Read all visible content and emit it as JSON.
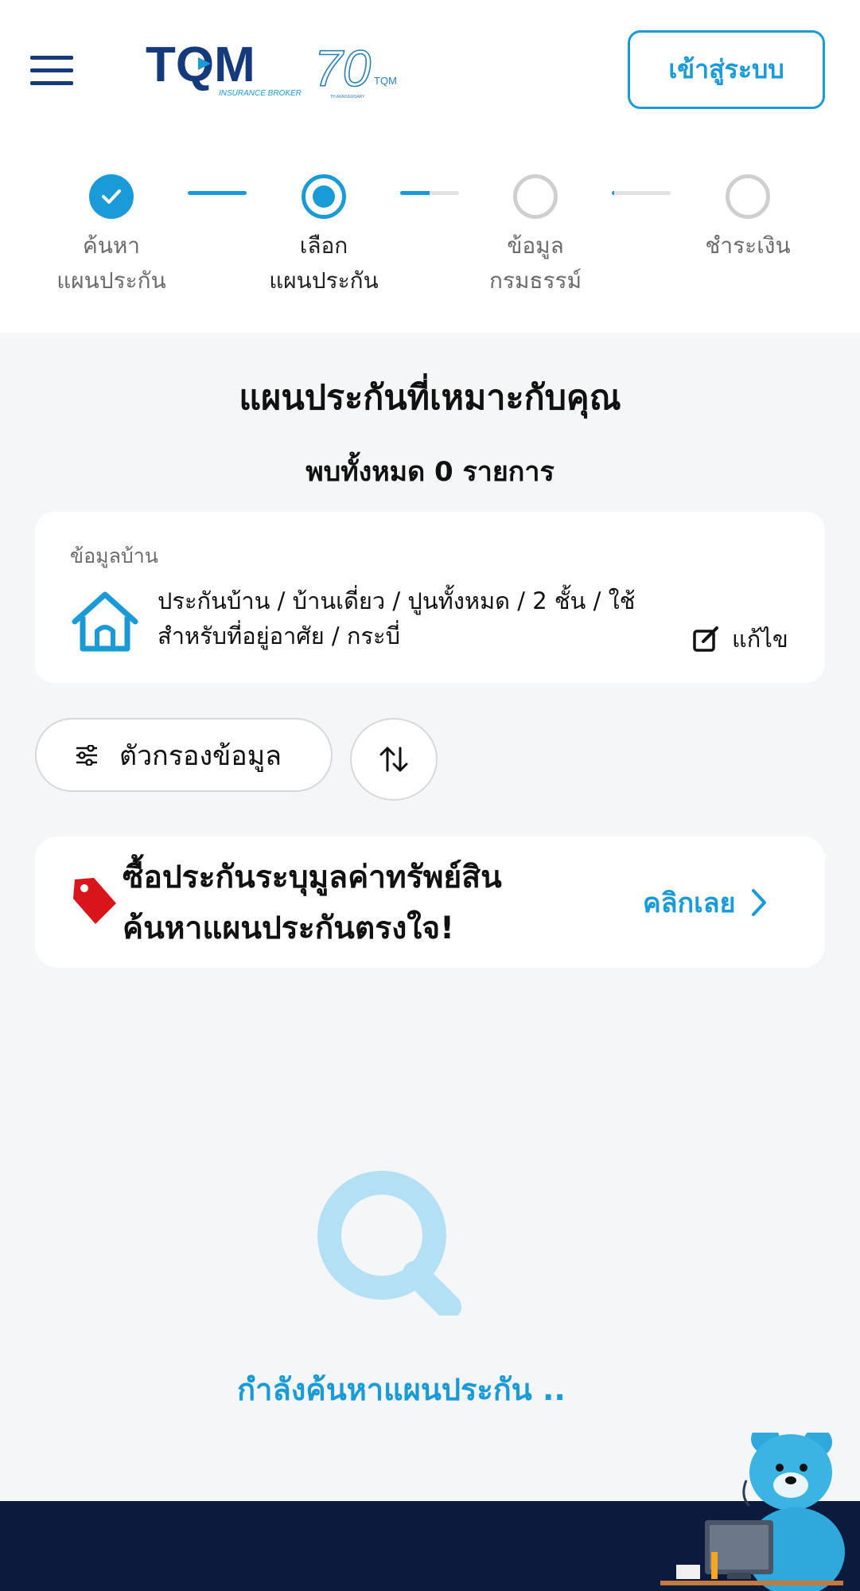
{
  "header": {
    "logo_text": "TQM",
    "logo_subtext": "INSURANCE BROKER",
    "anniversary_text": "70",
    "anniversary_brand": "TQM",
    "anniversary_label": "TH ANNIVERSARY",
    "login_label": "เข้าสู่ระบบ"
  },
  "stepper": {
    "steps": [
      {
        "line1": "ค้นหา",
        "line2": "แผนประกัน",
        "state": "done"
      },
      {
        "line1": "เลือก",
        "line2": "แผนประกัน",
        "state": "current"
      },
      {
        "line1": "ข้อมูล",
        "line2": "กรมธรรม์",
        "state": "todo"
      },
      {
        "line1": "ชำระเงิน",
        "line2": "",
        "state": "todo"
      }
    ],
    "connector_progress": [
      1.0,
      0.5,
      0.0
    ]
  },
  "main": {
    "title": "แผนประกันที่เหมาะกับคุณ",
    "result_count": "พบทั้งหมด 0 รายการ"
  },
  "home_info": {
    "caption": "ข้อมูลบ้าน",
    "description": "ประกันบ้าน / บ้านเดี่ยว / ปูนทั้งหมด / 2 ชั้น / ใช้สำหรับที่อยู่อาศัย / กระบี่",
    "edit_label": "แก้ไข",
    "icon": "house-icon"
  },
  "toolbar": {
    "filter_label": "ตัวกรองข้อมูล",
    "filter_icon": "sliders-icon",
    "sort_icon": "sort-arrows-icon"
  },
  "promo": {
    "line1": "ซื้อประกันระบุมูลค่าทรัพย์สิน",
    "line2": "ค้นหาแผนประกันตรงใจ!",
    "cta_label": "คลิกเลย",
    "icon": "price-tag-icon"
  },
  "loading": {
    "text": "กำลังค้นหาแผนประกัน .."
  },
  "colors": {
    "accent": "#1a9ad7",
    "navy": "#143a7b",
    "footer": "#0c1a3d",
    "tag_red": "#d9141b",
    "background": "#f5f6f8"
  }
}
